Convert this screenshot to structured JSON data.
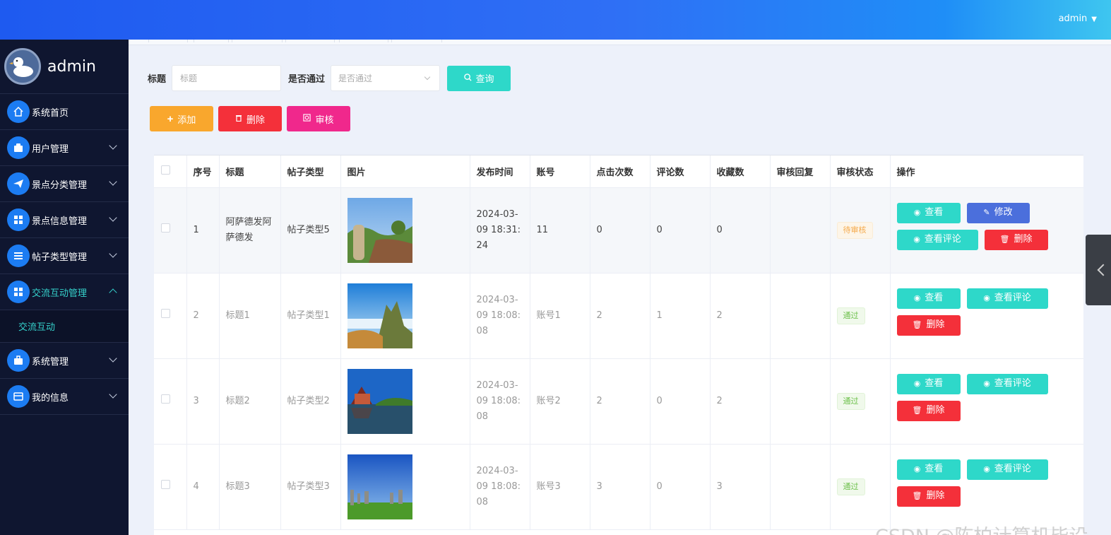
{
  "header": {
    "user": "admin"
  },
  "sidebar": {
    "brand": "admin",
    "items": [
      {
        "label": "系统首页"
      },
      {
        "label": "用户管理"
      },
      {
        "label": "景点分类管理"
      },
      {
        "label": "景点信息管理"
      },
      {
        "label": "帖子类型管理"
      },
      {
        "label": "交流互动管理"
      },
      {
        "label": "系统管理"
      },
      {
        "label": "我的信息"
      }
    ],
    "sub_item": "交流互动"
  },
  "search": {
    "title_label": "标题",
    "title_placeholder": "标题",
    "pass_label": "是否通过",
    "pass_placeholder": "是否通过",
    "query_button": "查询"
  },
  "actions": {
    "add": "添加",
    "delete": "删除",
    "audit": "审核"
  },
  "table": {
    "columns": [
      "序号",
      "标题",
      "帖子类型",
      "图片",
      "发布时间",
      "账号",
      "点击次数",
      "评论数",
      "收藏数",
      "审核回复",
      "审核状态",
      "操作"
    ],
    "rows": [
      {
        "no": "1",
        "title": "阿萨德发阿萨德发",
        "type": "帖子类型5",
        "time": "2024-03-09 18:31:24",
        "account": "11",
        "clicks": "0",
        "comments": "0",
        "favorites": "0",
        "reply": "",
        "status": "待审核"
      },
      {
        "no": "2",
        "title": "标题1",
        "type": "帖子类型1",
        "time": "2024-03-09 18:08:08",
        "account": "账号1",
        "clicks": "2",
        "comments": "1",
        "favorites": "2",
        "reply": "",
        "status": "通过"
      },
      {
        "no": "3",
        "title": "标题2",
        "type": "帖子类型2",
        "time": "2024-03-09 18:08:08",
        "account": "账号2",
        "clicks": "2",
        "comments": "0",
        "favorites": "2",
        "reply": "",
        "status": "通过"
      },
      {
        "no": "4",
        "title": "标题3",
        "type": "帖子类型3",
        "time": "2024-03-09 18:08:08",
        "account": "账号3",
        "clicks": "3",
        "comments": "0",
        "favorites": "3",
        "reply": "",
        "status": "通过"
      }
    ],
    "ops": {
      "view": "查看",
      "edit": "修改",
      "view_comments": "查看评论",
      "delete": "删除"
    }
  },
  "watermark": "CSDN @陈柏计算机毕设",
  "colors": {
    "accent": "#2ed8c9",
    "danger": "#f4303a",
    "warning": "#f9a72d",
    "primary": "#4b6fdc",
    "audit": "#f0288c",
    "sidebar": "#0f1630"
  }
}
